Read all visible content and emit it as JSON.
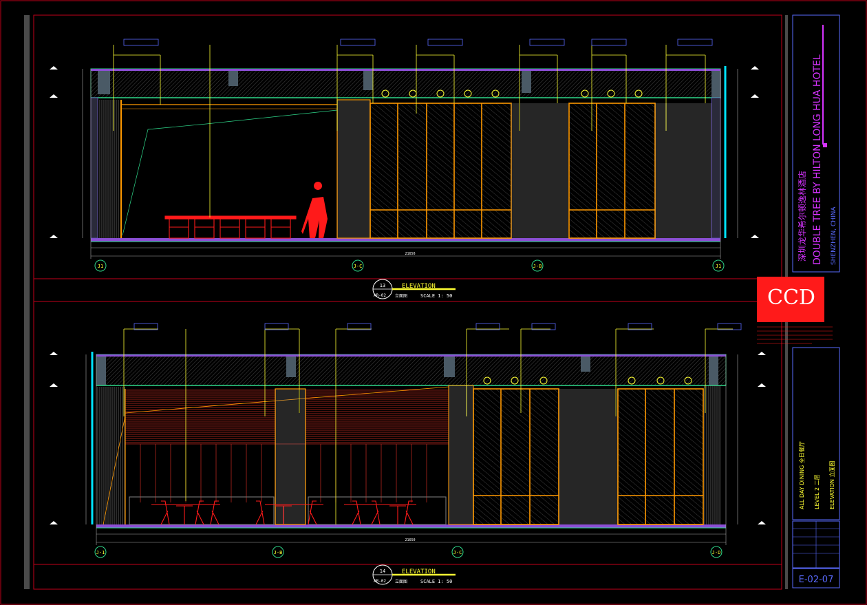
{
  "upper": {
    "caption_number": "13",
    "caption_sheet": "AR-02",
    "caption_title": "ELEVATION",
    "caption_sub": "立面图",
    "caption_scale": "SCALE 1:   50",
    "grid_tags": [
      "J1",
      "J-C",
      "J-B",
      "J1"
    ],
    "total_dim": "21650"
  },
  "lower": {
    "caption_number": "14",
    "caption_sheet": "AR-02",
    "caption_title": "ELEVATION",
    "caption_sub": "立面图",
    "caption_scale": "SCALE 1:   50",
    "grid_tags": [
      "J-1",
      "J-B",
      "J-C",
      "J-D"
    ],
    "total_dim": "21650"
  },
  "title_block": {
    "project_cn": "深圳龙华希尔顿逸林酒店",
    "project_en": "DOUBLE TREE BY HILTON LONG HUA HOTEL",
    "city": "SHENZHEN, CHINA",
    "firm_logo": "CCD",
    "drawing_title_1": "ALL DAY DINING  全日餐厅",
    "drawing_title_2": "LEVEL 2  二层",
    "drawing_title_3": "ELEVATION  立面图",
    "sheet_number": "E-02-07"
  },
  "colors": {
    "frame": "#c4001a",
    "yellow": "#ffff33",
    "orange": "#ff9900",
    "cyan": "#00e5ff",
    "green": "#2fd98b",
    "magenta": "#d633ff",
    "red": "#ff1a1a",
    "blue_text": "#5a6bff"
  }
}
